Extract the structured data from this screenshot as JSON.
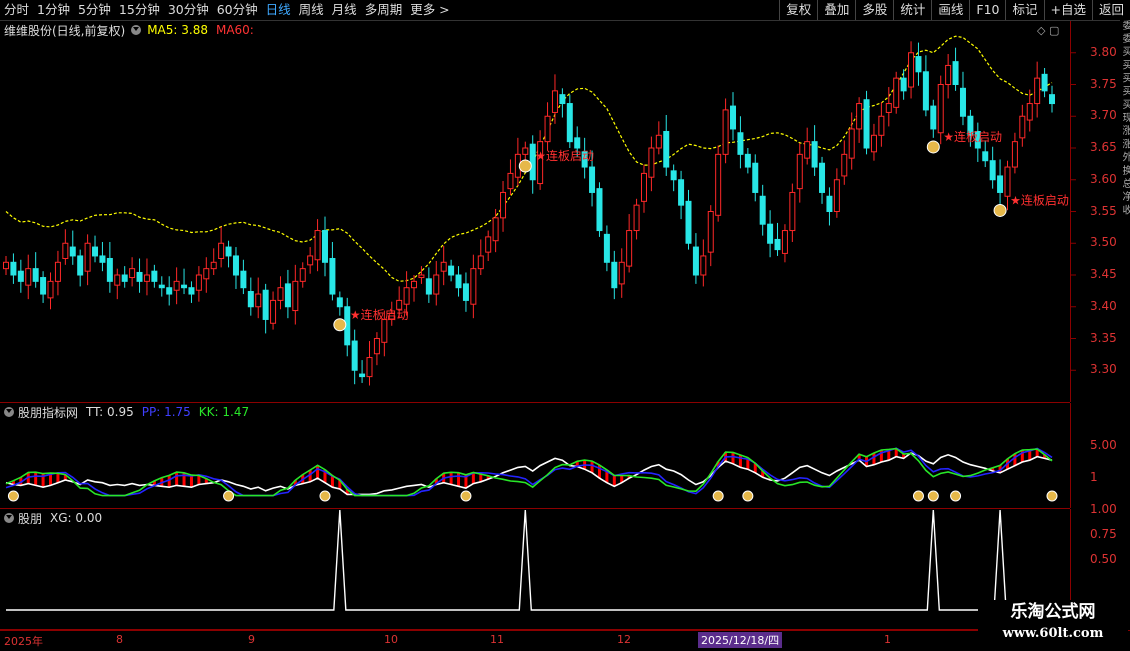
{
  "toolbar": {
    "periods": [
      "分时",
      "1分钟",
      "5分钟",
      "15分钟",
      "30分钟",
      "60分钟",
      "日线",
      "周线",
      "月线",
      "多周期",
      "更多 >"
    ],
    "active_period": "日线",
    "buttons": [
      "复权",
      "叠加",
      "多股",
      "统计",
      "画线",
      "F10",
      "标记",
      "+自选",
      "返回"
    ]
  },
  "main_panel": {
    "title": "维维股份(日线,前复权)",
    "ma5_label": "MA5: 3.88",
    "ma60_label": "MA60:",
    "yticks": [
      "3.80",
      "3.75",
      "3.70",
      "3.65",
      "3.60",
      "3.55",
      "3.50",
      "3.45",
      "3.40",
      "3.35",
      "3.30"
    ],
    "signal_label": "连板启动",
    "right_strip_text": "委 委 买 买 买 买 买 现 涨 涨 外 换 总 净 收"
  },
  "indicator_panel": {
    "title": "股朋指标网",
    "tt_label": "TT: 0.95",
    "pp_label": "PP: 1.75",
    "kk_label": "KK: 1.47",
    "yticks": [
      "5.00",
      "1"
    ]
  },
  "signal_panel": {
    "title": "股朋",
    "xg_label": "XG: 0.00",
    "yticks": [
      "1.00",
      "0.75",
      "0.50"
    ]
  },
  "xaxis": {
    "labels": [
      "2025年",
      "8",
      "9",
      "10",
      "11",
      "12",
      "2025/12/18/四",
      "1",
      "2"
    ]
  },
  "watermark": {
    "line1": "乐淘公式网",
    "line2": "www.60lt.com"
  },
  "colors": {
    "up": "#ff2828",
    "down": "#28e6e6",
    "ma5": "#ffff00",
    "tt": "#ff0000",
    "pp": "#2424ff",
    "kk": "#28e628",
    "axis": "#8b0000"
  },
  "chart_data": [
    {
      "type": "candlestick",
      "title": "维维股份(日线,前复权)",
      "ylim": [
        3.25,
        3.85
      ],
      "series": [
        {
          "name": "MA5",
          "values": [
            3.88
          ]
        }
      ],
      "candles_close": [
        3.47,
        3.45,
        3.44,
        3.46,
        3.44,
        3.42,
        3.44,
        3.47,
        3.5,
        3.48,
        3.45,
        3.5,
        3.48,
        3.47,
        3.44,
        3.45,
        3.44,
        3.46,
        3.44,
        3.45,
        3.44,
        3.43,
        3.42,
        3.44,
        3.43,
        3.42,
        3.45,
        3.46,
        3.47,
        3.5,
        3.48,
        3.45,
        3.43,
        3.4,
        3.42,
        3.38,
        3.41,
        3.43,
        3.4,
        3.44,
        3.46,
        3.48,
        3.52,
        3.47,
        3.42,
        3.4,
        3.34,
        3.3,
        3.29,
        3.32,
        3.35,
        3.38,
        3.39,
        3.41,
        3.43,
        3.44,
        3.45,
        3.42,
        3.45,
        3.47,
        3.45,
        3.43,
        3.41,
        3.46,
        3.48,
        3.51,
        3.54,
        3.58,
        3.61,
        3.64,
        3.65,
        3.6,
        3.66,
        3.7,
        3.74,
        3.72,
        3.66,
        3.65,
        3.62,
        3.58,
        3.52,
        3.47,
        3.43,
        3.47,
        3.52,
        3.56,
        3.61,
        3.65,
        3.67,
        3.62,
        3.6,
        3.56,
        3.5,
        3.45,
        3.48,
        3.55,
        3.64,
        3.71,
        3.68,
        3.64,
        3.62,
        3.58,
        3.53,
        3.5,
        3.49,
        3.52,
        3.58,
        3.64,
        3.66,
        3.62,
        3.58,
        3.55,
        3.6,
        3.64,
        3.68,
        3.72,
        3.65,
        3.67,
        3.7,
        3.72,
        3.76,
        3.74,
        3.8,
        3.77,
        3.71,
        3.68,
        3.75,
        3.78,
        3.75,
        3.7,
        3.67,
        3.65,
        3.63,
        3.6,
        3.58,
        3.62,
        3.66,
        3.7,
        3.72,
        3.76,
        3.74,
        3.72
      ]
    },
    {
      "type": "line",
      "title": "股朋指标网",
      "series": [
        {
          "name": "TT",
          "values": [
            0.95
          ]
        },
        {
          "name": "PP",
          "values": [
            1.75
          ]
        },
        {
          "name": "KK",
          "values": [
            1.47
          ]
        }
      ]
    },
    {
      "type": "line",
      "title": "股朋",
      "ylim": [
        0,
        1
      ],
      "series": [
        {
          "name": "XG",
          "values": [
            0.0
          ]
        }
      ],
      "spikes_at_index": [
        45,
        70,
        125,
        134
      ]
    }
  ]
}
